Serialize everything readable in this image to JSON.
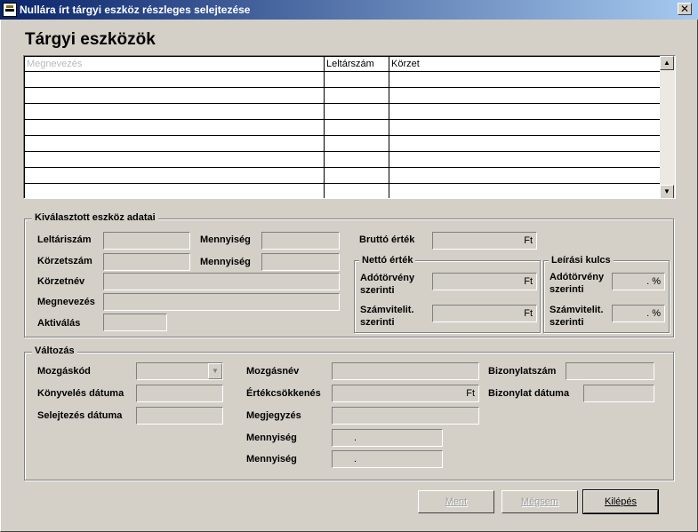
{
  "window": {
    "title": "Nullára írt tárgyi eszköz részleges selejtezése",
    "close_glyph": "✕"
  },
  "main": {
    "heading": "Tárgyi eszközök"
  },
  "table": {
    "columns": [
      "Megnevezés",
      "Leltárszám",
      "Körzet"
    ],
    "rows": [
      [
        "",
        "",
        ""
      ],
      [
        "",
        "",
        ""
      ],
      [
        "",
        "",
        ""
      ],
      [
        "",
        "",
        ""
      ],
      [
        "",
        "",
        ""
      ],
      [
        "",
        "",
        ""
      ],
      [
        "",
        "",
        ""
      ],
      [
        "",
        "",
        ""
      ]
    ]
  },
  "selected": {
    "legend": "Kiválasztott eszköz adatai",
    "leltarszam_label": "Leltáriszám",
    "korzetszam_label": "Körzetszám",
    "korzetnev_label": "Körzetnév",
    "megnevezes_label": "Megnevezés",
    "aktivalas_label": "Aktiválás",
    "mennyiseg1_label": "Mennyiség",
    "mennyiseg2_label": "Mennyiség",
    "brutto_label": "Bruttó érték",
    "brutto_value": "Ft",
    "netto_legend": "Nettó érték",
    "ado_label": "Adótörvény\nszerinti",
    "ado_value": "Ft",
    "szam_label": "Számvitelit.\nszerinti",
    "szam_value": "Ft",
    "leiras_legend": "Leírási kulcs",
    "leiras_ado_label": "Adótörvény\nszerinti",
    "leiras_ado_value": ". %",
    "leiras_szam_label": "Számvitelit.\nszerinti",
    "leiras_szam_value": ". %"
  },
  "change": {
    "legend": "Változás",
    "mozgaskod_label": "Mozgáskód",
    "konyveles_label": "Könyvelés dátuma",
    "selejtezes_label": "Selejtezés dátuma",
    "mozgasnev_label": "Mozgásnév",
    "ertekcsokkenes_label": "Értékcsökkenés",
    "ertekcsokkenes_value": "Ft",
    "megjegyzes_label": "Megjegyzés",
    "mennyiseg1_label": "Mennyiség",
    "mennyiseg1_value": ".",
    "mennyiseg2_label": "Mennyiség",
    "mennyiseg2_value": ".",
    "bizonylatszam_label": "Bizonylatszám",
    "bizonylat_datum_label": "Bizonylat dátuma"
  },
  "buttons": {
    "save": "Ment",
    "cancel": "Mégsem",
    "exit": "Kilépés"
  }
}
